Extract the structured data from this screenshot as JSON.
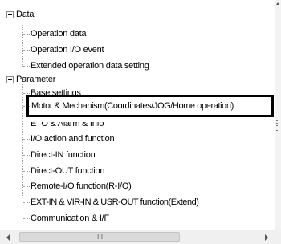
{
  "tree": {
    "groups": [
      {
        "label": "Data",
        "children": [
          "Operation data",
          "Operation I/O event",
          "Extended operation data setting"
        ]
      },
      {
        "label": "Parameter",
        "children": [
          "Base settings",
          "Motor & Mechanism(Coordinates/JOG/Home operation)",
          "ETO & Alarm & Info",
          "I/O action and function",
          "Direct-IN function",
          "Direct-OUT function",
          "Remote-I/O function(R-I/O)",
          "EXT-IN & VIR-IN & USR-OUT function(Extend)",
          "Communication & I/F"
        ]
      }
    ]
  },
  "hscroll": {
    "grip": "III"
  },
  "icons": {
    "expander": "collapse-minus-icon",
    "left": "left-arrow-icon",
    "right": "right-arrow-icon"
  }
}
